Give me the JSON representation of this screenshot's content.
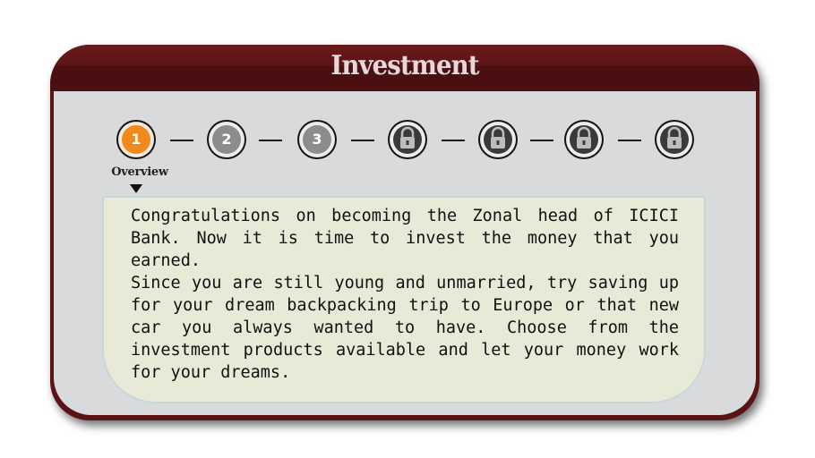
{
  "header": {
    "title": "Investment"
  },
  "steps": [
    {
      "label": "1",
      "state": "active",
      "icon": ""
    },
    {
      "label": "2",
      "state": "unlocked",
      "icon": ""
    },
    {
      "label": "3",
      "state": "unlocked",
      "icon": ""
    },
    {
      "label": "",
      "state": "locked",
      "icon": "lock-icon"
    },
    {
      "label": "",
      "state": "locked",
      "icon": "lock-icon"
    },
    {
      "label": "",
      "state": "locked",
      "icon": "lock-icon"
    },
    {
      "label": "",
      "state": "locked",
      "icon": "lock-icon"
    }
  ],
  "current_step": {
    "label": "Overview"
  },
  "content": {
    "text": "Congratulations on becoming the Zonal head of ICICI Bank. Now it is time to invest the money that you earned.\nSince you are still young and unmarried, try saving up for your dream backpacking trip to Europe or that new car you always wanted to have. Choose from the investment products available and let your money work for your dreams."
  },
  "colors": {
    "panel_frame": "#5a1416",
    "panel_body": "#d8dadc",
    "active_step": "#f08a1c",
    "unlocked_step": "#8c8c8c",
    "locked_step": "#3a3a3a",
    "text_box": "#e9e9d8"
  }
}
